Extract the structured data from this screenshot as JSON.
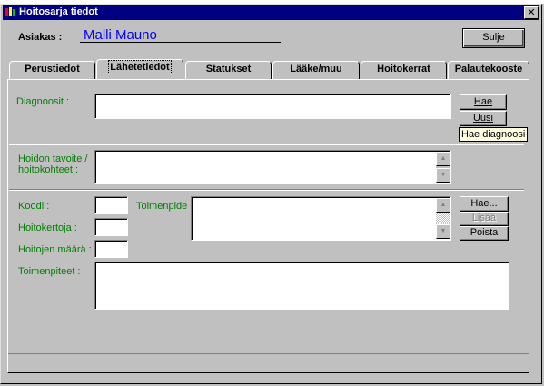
{
  "window": {
    "title": "Hoitosarja tiedot",
    "close_glyph": "✕",
    "icon": "app-icon"
  },
  "header": {
    "client_label": "Asiakas :",
    "client_name": "Malli Mauno",
    "close_button": "Sulje"
  },
  "tabs": [
    {
      "label": "Perustiedot",
      "active": false
    },
    {
      "label": "Lähetetiedot",
      "active": true
    },
    {
      "label": "Statukset",
      "active": false
    },
    {
      "label": "Lääke/muu",
      "active": false
    },
    {
      "label": "Hoitokerrat",
      "active": false
    },
    {
      "label": "Palautekooste",
      "active": false
    }
  ],
  "diagnoses": {
    "label": "Diagnoosit :",
    "value": "",
    "fetch_button": "Hae",
    "new_button": "Uusi",
    "tooltip": "Hae diagnoosi"
  },
  "goal": {
    "label_line1": "Hoidon tavoite /",
    "label_line2": "hoitokohteet :",
    "value": ""
  },
  "procedures": {
    "code_label": "Koodi :",
    "code_value": "",
    "sessions_label": "Hoitokertoja :",
    "sessions_value": "",
    "amount_label": "Hoitojen määrä :",
    "amount_value": "",
    "procedure_label": "Toimenpide :",
    "procedure_value": "",
    "fetch_button": "Hae...",
    "add_button": "Lisää",
    "remove_button": "Poista",
    "list_label": "Toimenpiteet :",
    "list_value": ""
  },
  "colors": {
    "titlebar": "#000080",
    "label_green": "#008000",
    "client_blue": "#0000ff",
    "face": "#c0c0c0"
  }
}
